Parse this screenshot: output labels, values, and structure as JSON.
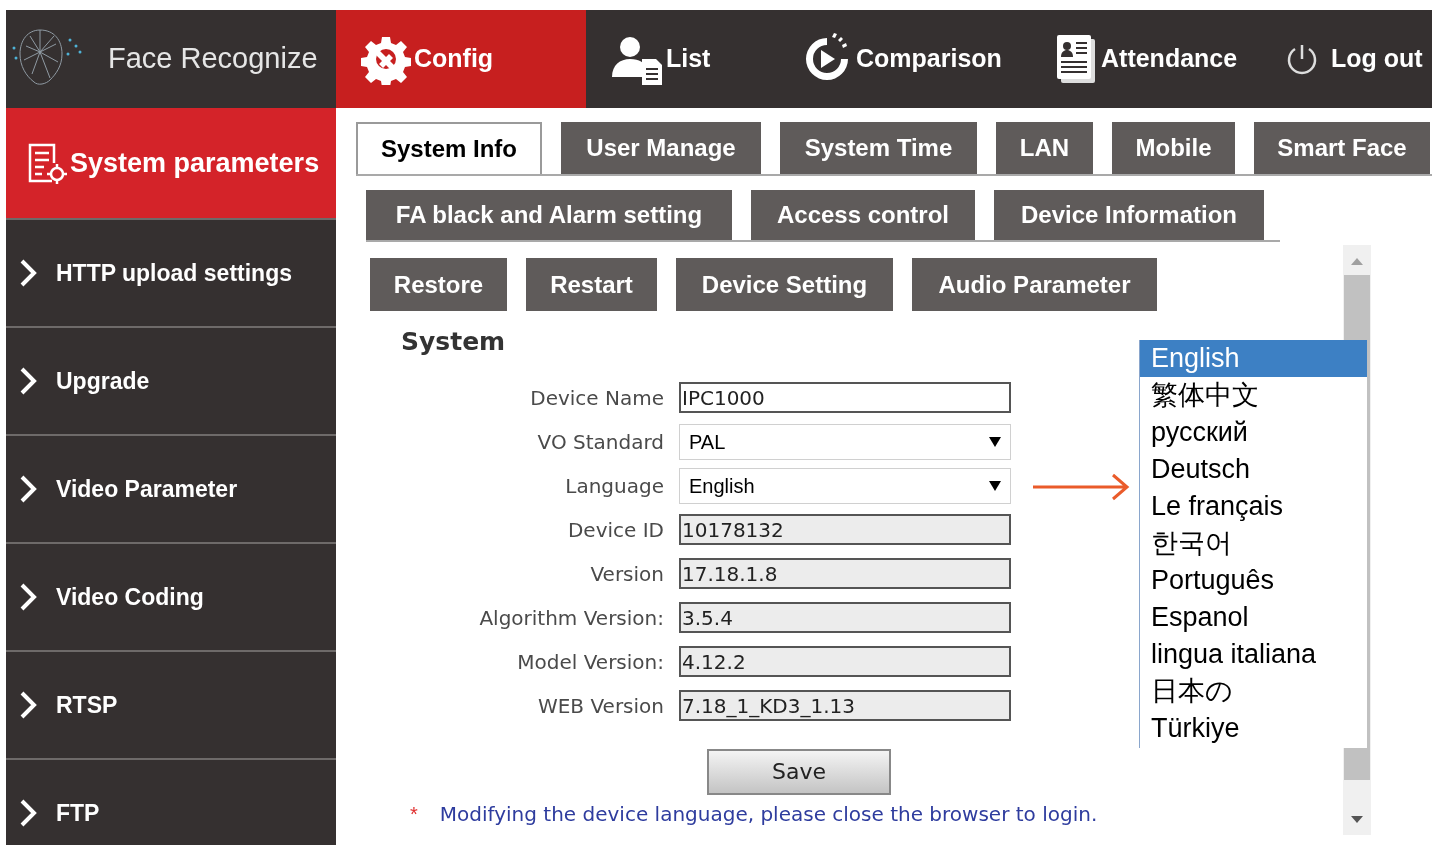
{
  "header": {
    "brand": "Face Recognize",
    "nav": [
      {
        "label": "Config",
        "kind": "gear",
        "selected": true
      },
      {
        "label": "List",
        "kind": "user",
        "selected": false
      },
      {
        "label": "Comparison",
        "kind": "timer",
        "selected": false
      },
      {
        "label": "Attendance",
        "kind": "card",
        "selected": false
      },
      {
        "label": "Log out",
        "kind": "power",
        "selected": false
      }
    ]
  },
  "sidebar": {
    "items": [
      {
        "label": "System parameters",
        "selected": true
      },
      {
        "label": "HTTP upload settings",
        "selected": false
      },
      {
        "label": "Upgrade",
        "selected": false
      },
      {
        "label": "Video Parameter",
        "selected": false
      },
      {
        "label": "Video Coding",
        "selected": false
      },
      {
        "label": "RTSP",
        "selected": false
      },
      {
        "label": "FTP",
        "selected": false
      }
    ]
  },
  "tab_rows": [
    [
      {
        "label": "System Info",
        "selected": true
      },
      {
        "label": "User Manage",
        "selected": false
      },
      {
        "label": "System Time",
        "selected": false
      },
      {
        "label": "LAN",
        "selected": false
      },
      {
        "label": "Mobile",
        "selected": false
      },
      {
        "label": "Smart Face",
        "selected": false
      }
    ],
    [
      {
        "label": "FA black and Alarm setting",
        "selected": false
      },
      {
        "label": "Access control",
        "selected": false
      },
      {
        "label": "Device Information",
        "selected": false
      }
    ]
  ],
  "actions": [
    "Restore",
    "Restart",
    "Device Setting",
    "Audio Parameter"
  ],
  "section_title": "System",
  "fields": [
    {
      "label": "Device Name",
      "value": "IPC1000",
      "kind": "text"
    },
    {
      "label": "VO Standard",
      "value": "PAL",
      "kind": "select"
    },
    {
      "label": "Language",
      "value": "English",
      "kind": "select"
    },
    {
      "label": "Device ID",
      "value": "10178132",
      "kind": "readonly"
    },
    {
      "label": "Version",
      "value": "17.18.1.8",
      "kind": "readonly"
    },
    {
      "label": "Algorithm Version:",
      "value": "3.5.4",
      "kind": "readonly"
    },
    {
      "label": "Model Version:",
      "value": "4.12.2",
      "kind": "readonly"
    },
    {
      "label": "WEB Version",
      "value": "7.18_1_KD3_1.13",
      "kind": "readonly"
    }
  ],
  "save_button": "Save",
  "note": {
    "mark": "*",
    "text": "Modifying the device language, please close the browser to login."
  },
  "language_list": {
    "options": [
      {
        "label": "English",
        "selected": true
      },
      {
        "label": "繁体中文",
        "selected": false
      },
      {
        "label": "русский",
        "selected": false
      },
      {
        "label": "Deutsch",
        "selected": false
      },
      {
        "label": "Le français",
        "selected": false
      },
      {
        "label": "한국어",
        "selected": false
      },
      {
        "label": "Português",
        "selected": false
      },
      {
        "label": "Espanol",
        "selected": false
      },
      {
        "label": "lingua italiana",
        "selected": false
      },
      {
        "label": "日本の",
        "selected": false
      },
      {
        "label": "Türkiye",
        "selected": false
      }
    ]
  }
}
